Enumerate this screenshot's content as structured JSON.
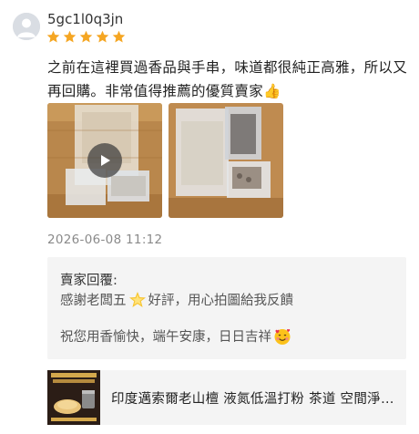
{
  "review": {
    "username": "5gc1l0q3jn",
    "rating": 5,
    "text": "之前在這裡買過香品與手串，味道都很純正高雅，所以又再回購。非常值得推薦的優質賣家👍",
    "timestamp": "2026-06-08 11:12",
    "star_color": "#f5a623",
    "media": [
      {
        "type": "video",
        "icon": "play-icon"
      },
      {
        "type": "image"
      }
    ]
  },
  "seller_reply": {
    "title": "賣家回覆:",
    "line1_pre": "感謝老闆五",
    "line1_emoji": "glowing-star-icon",
    "line1_post": "好評，用心拍圖給我反饋",
    "line2_text": "祝您用香愉快，端午安康，日日吉祥",
    "line2_emoji": "smiling-face-with-hearts-icon"
  },
  "product": {
    "name": "印度邁索爾老山檀 液氮低溫打粉 茶道 空間淨化 香道用品",
    "thumb_caption": "液氮低溫打粉"
  }
}
